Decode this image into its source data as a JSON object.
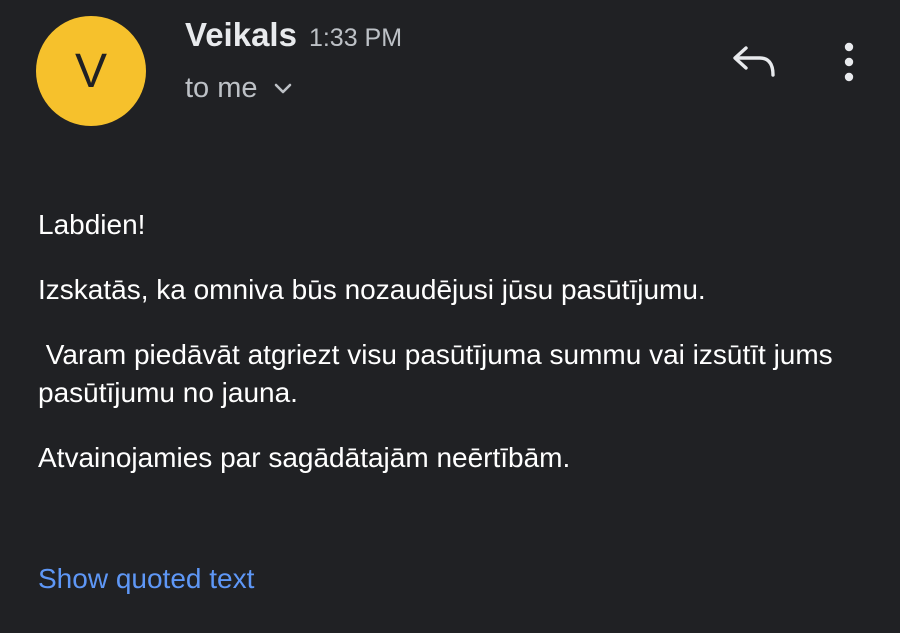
{
  "sender": {
    "avatar_letter": "V",
    "avatar_color": "#f6c12c",
    "name": "Veikals",
    "time": "1:33 PM",
    "recipient": "to me"
  },
  "icons": {
    "reply": "reply-icon",
    "more": "more-vert-icon",
    "expand": "chevron-down-icon"
  },
  "message": {
    "greeting": "Labdien!",
    "line1": "Izskatās, ka omniva būs nozaudējusi jūsu pasūtījumu.",
    "line2": " Varam piedāvāt atgriezt visu pasūtījuma summu vai izsūtīt jums pasūtījumu no jauna.",
    "line3": "Atvainojamies par sagādātajām neērtībām."
  },
  "footer": {
    "show_quoted": "Show quoted text"
  },
  "colors": {
    "background": "#202124",
    "link": "#5e97f6",
    "text": "#ffffff",
    "secondary_text": "#bdc1c6"
  }
}
